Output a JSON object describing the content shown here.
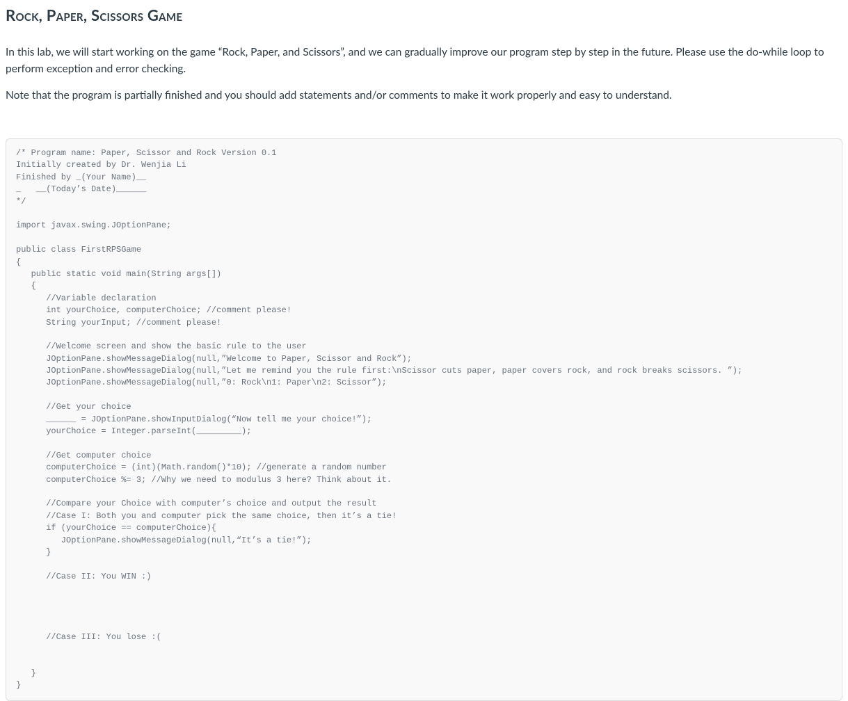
{
  "title": "Rock, Paper, Scissors Game",
  "paragraphs": {
    "intro": "In this lab, we will start working on the game “Rock, Paper, and Scissors”, and we can gradually improve our program step by step in the future. Please use the do-while loop to perform exception and error checking.",
    "note": "Note that the program is partially finished and you should add statements and/or comments to make it work properly and easy to understand."
  },
  "code": "/* Program name: Paper, Scissor and Rock Version 0.1\nInitially created by Dr. Wenjia Li\nFinished by _(Your Name)__\n_   __(Today’s Date)______\n*/\n\nimport javax.swing.JOptionPane;\n\npublic class FirstRPSGame\n{\n   public static void main(String args[])\n   {\n      //Variable declaration\n      int yourChoice, computerChoice; //comment please!\n      String yourInput; //comment please!\n\n      //Welcome screen and show the basic rule to the user\n      JOptionPane.showMessageDialog(null,”Welcome to Paper, Scissor and Rock”);\n      JOptionPane.showMessageDialog(null,”Let me remind you the rule first:\\nScissor cuts paper, paper covers rock, and rock breaks scissors. ”);\n      JOptionPane.showMessageDialog(null,”0: Rock\\n1: Paper\\n2: Scissor”);\n\n      //Get your choice\n      ______ = JOptionPane.showInputDialog(“Now tell me your choice!”);\n      yourChoice = Integer.parseInt(_________);\n\n      //Get computer choice\n      computerChoice = (int)(Math.random()*10); //generate a random number\n      computerChoice %= 3; //Why we need to modulus 3 here? Think about it.\n\n      //Compare your Choice with computer’s choice and output the result\n      //Case I: Both you and computer pick the same choice, then it’s a tie!\n      if (yourChoice == computerChoice){\n         JOptionPane.showMessageDialog(null,“It’s a tie!”);\n      }\n\n      //Case II: You WIN :)\n\n\n\n\n      //Case III: You lose :(\n\n\n   }\n}"
}
